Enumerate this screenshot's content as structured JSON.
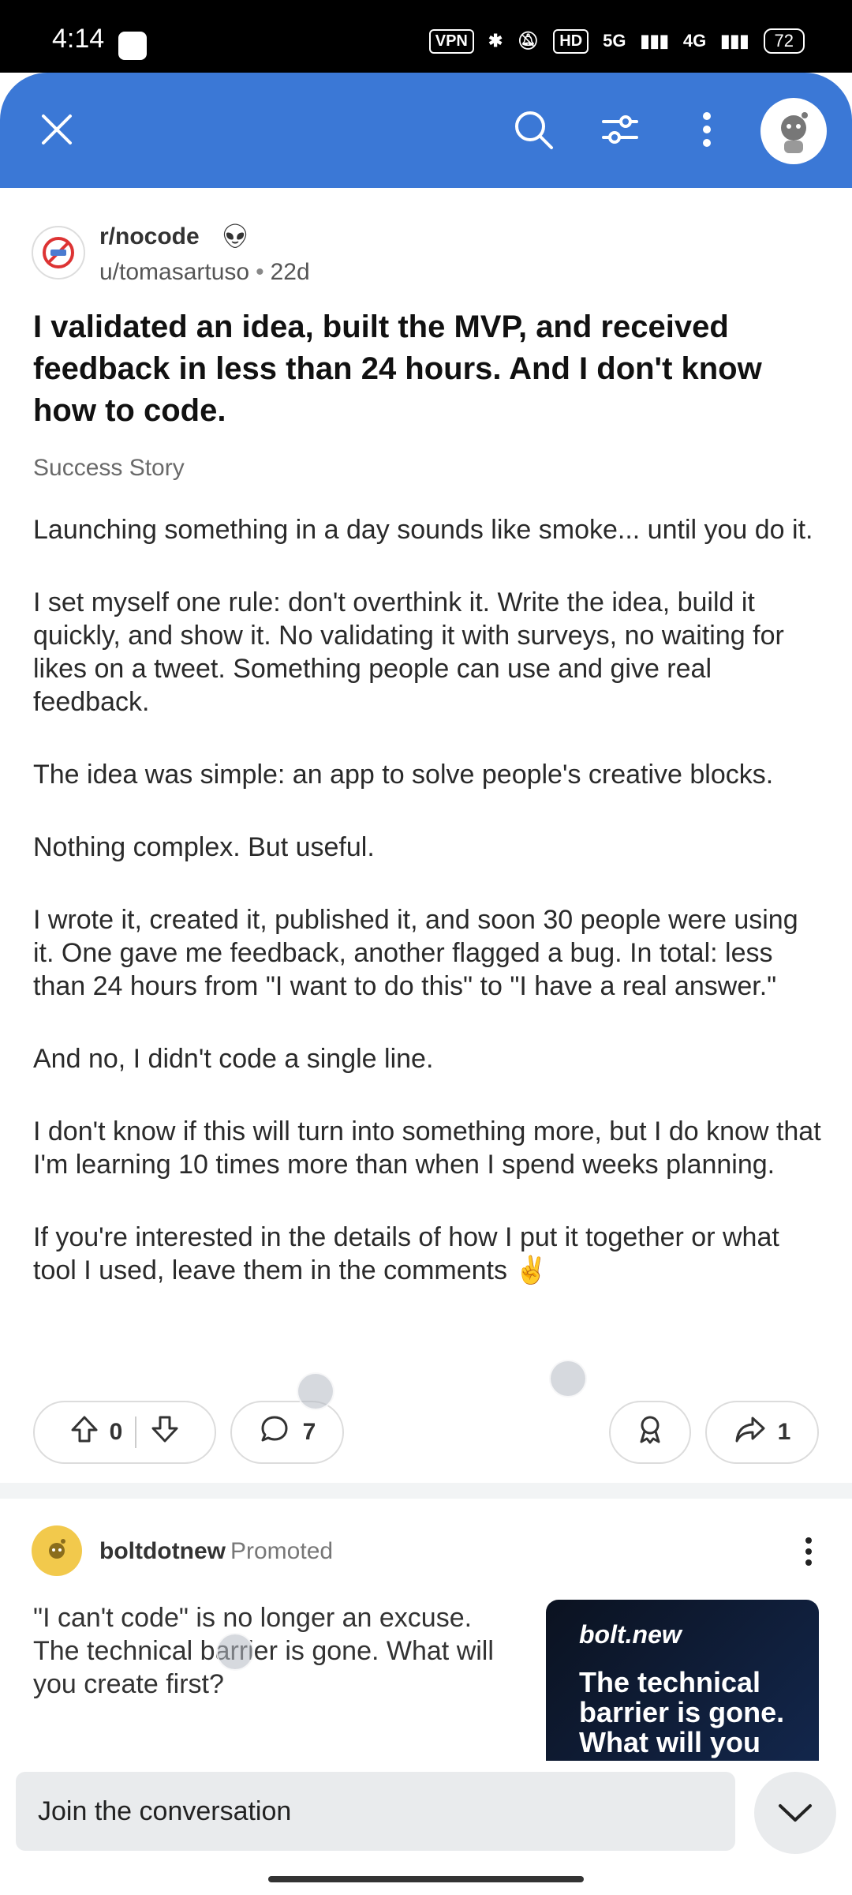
{
  "status_bar": {
    "time": "4:14",
    "vpn": "VPN",
    "hd": "HD",
    "net1": "5G",
    "net2": "4G",
    "battery": "72"
  },
  "toolbar": {
    "close_icon": "close-icon",
    "search_icon": "search-icon",
    "filter_icon": "filter-icon",
    "more_icon": "more-vertical-icon",
    "avatar": "user-avatar"
  },
  "post": {
    "subreddit": "r/nocode",
    "author": "u/tomasartuso",
    "age": "22d",
    "title": "I validated an idea, built the MVP, and received feedback in less than 24 hours. And I don't know how to code.",
    "flair": "Success Story",
    "paragraphs": [
      "Launching something in a day sounds like smoke... until you do it.",
      "I set myself one rule: don't overthink it. Write the idea, build it quickly, and show it. No validating it with surveys, no waiting for likes on a tweet. Something people can use and give real feedback.",
      "The idea was simple: an app to solve people's creative blocks.",
      "Nothing complex. But useful.",
      "I wrote it, created it, published it, and soon 30 people were using it. One gave me feedback, another flagged a bug. In total: less than 24 hours from \"I want to do this\" to \"I have a real answer.\"",
      "And no, I didn't code a single line.",
      "I don't know if this will turn into something more, but I do know that I'm learning 10 times more than when I spend weeks planning.",
      "If you're interested in the details of how I put it together or what tool I used, leave them in the comments ✌️"
    ],
    "votes": "0",
    "comments": "7",
    "shares": "1"
  },
  "promo": {
    "name": "boltdotnew",
    "tag": "Promoted",
    "text": "\"I can't code\" is no longer an excuse. The technical barrier is gone. What will you create first?",
    "image_logo": "bolt.new",
    "image_headline": "The technical barrier is gone. What will you"
  },
  "composer": {
    "placeholder": "Join the conversation"
  },
  "colors": {
    "header": "#3b78d6",
    "text": "#1c1c1c",
    "muted": "#6a6a6a"
  }
}
